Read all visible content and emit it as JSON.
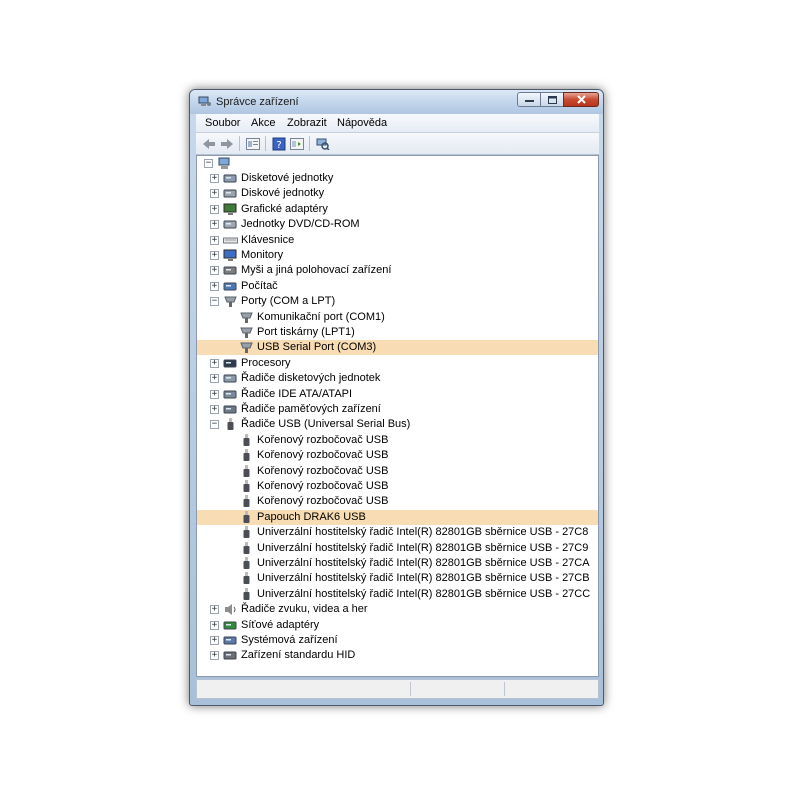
{
  "window": {
    "title": "Správce zařízení",
    "accent_color": "#f8dcb3"
  },
  "menu": [
    {
      "label": "Soubor"
    },
    {
      "label": "Akce"
    },
    {
      "label": "Zobrazit"
    },
    {
      "label": "Nápověda"
    }
  ],
  "toolbar": {
    "icons": [
      "back-arrow-icon",
      "forward-arrow-icon",
      "view-tree-icon",
      "help-icon",
      "properties-icon",
      "scan-hardware-icon"
    ]
  },
  "tree": {
    "root_icon": "computer-icon",
    "items": [
      {
        "label": "Disketové jednotky",
        "level": 1,
        "expander": "+",
        "icon": "floppy-drive-icon"
      },
      {
        "label": "Diskové jednotky",
        "level": 1,
        "expander": "+",
        "icon": "hard-disk-icon"
      },
      {
        "label": "Grafické adaptéry",
        "level": 1,
        "expander": "+",
        "icon": "display-adapter-icon"
      },
      {
        "label": "Jednotky DVD/CD-ROM",
        "level": 1,
        "expander": "+",
        "icon": "dvd-drive-icon"
      },
      {
        "label": "Klávesnice",
        "level": 1,
        "expander": "+",
        "icon": "keyboard-icon"
      },
      {
        "label": "Monitory",
        "level": 1,
        "expander": "+",
        "icon": "monitor-icon"
      },
      {
        "label": "Myši a jiná polohovací zařízení",
        "level": 1,
        "expander": "+",
        "icon": "mouse-icon"
      },
      {
        "label": "Počítač",
        "level": 1,
        "expander": "+",
        "icon": "computer-icon"
      },
      {
        "label": "Porty (COM a LPT)",
        "level": 1,
        "expander": "−",
        "icon": "port-icon"
      },
      {
        "label": "Komunikační port (COM1)",
        "level": 2,
        "expander": "",
        "icon": "port-icon"
      },
      {
        "label": "Port tiskárny (LPT1)",
        "level": 2,
        "expander": "",
        "icon": "port-icon"
      },
      {
        "label": "USB Serial Port (COM3)",
        "level": 2,
        "expander": "",
        "icon": "port-icon",
        "selected": true
      },
      {
        "label": "Procesory",
        "level": 1,
        "expander": "+",
        "icon": "processor-icon"
      },
      {
        "label": "Řadiče disketových jednotek",
        "level": 1,
        "expander": "+",
        "icon": "floppy-controller-icon"
      },
      {
        "label": "Řadiče IDE ATA/ATAPI",
        "level": 1,
        "expander": "+",
        "icon": "ide-controller-icon"
      },
      {
        "label": "Řadiče paměťových zařízení",
        "level": 1,
        "expander": "+",
        "icon": "storage-controller-icon"
      },
      {
        "label": "Řadiče USB (Universal Serial Bus)",
        "level": 1,
        "expander": "−",
        "icon": "usb-icon"
      },
      {
        "label": "Kořenový rozbočovač USB",
        "level": 2,
        "expander": "",
        "icon": "usb-icon"
      },
      {
        "label": "Kořenový rozbočovač USB",
        "level": 2,
        "expander": "",
        "icon": "usb-icon"
      },
      {
        "label": "Kořenový rozbočovač USB",
        "level": 2,
        "expander": "",
        "icon": "usb-icon"
      },
      {
        "label": "Kořenový rozbočovač USB",
        "level": 2,
        "expander": "",
        "icon": "usb-icon"
      },
      {
        "label": "Kořenový rozbočovač USB",
        "level": 2,
        "expander": "",
        "icon": "usb-icon"
      },
      {
        "label": "Papouch DRAK6 USB",
        "level": 2,
        "expander": "",
        "icon": "usb-icon",
        "selected": true
      },
      {
        "label": "Univerzální hostitelský řadič Intel(R) 82801GB sběrnice USB - 27C8",
        "level": 2,
        "expander": "",
        "icon": "usb-icon"
      },
      {
        "label": "Univerzální hostitelský řadič Intel(R) 82801GB sběrnice USB - 27C9",
        "level": 2,
        "expander": "",
        "icon": "usb-icon"
      },
      {
        "label": "Univerzální hostitelský řadič Intel(R) 82801GB sběrnice USB - 27CA",
        "level": 2,
        "expander": "",
        "icon": "usb-icon"
      },
      {
        "label": "Univerzální hostitelský řadič Intel(R) 82801GB sběrnice USB - 27CB",
        "level": 2,
        "expander": "",
        "icon": "usb-icon"
      },
      {
        "label": "Univerzální hostitelský řadič Intel(R) 82801GB sběrnice USB - 27CC",
        "level": 2,
        "expander": "",
        "icon": "usb-icon"
      },
      {
        "label": "Řadiče zvuku, videa a her",
        "level": 1,
        "expander": "+",
        "icon": "speaker-icon"
      },
      {
        "label": "Síťové adaptéry",
        "level": 1,
        "expander": "+",
        "icon": "network-adapter-icon"
      },
      {
        "label": "Systémová zařízení",
        "level": 1,
        "expander": "+",
        "icon": "system-device-icon"
      },
      {
        "label": "Zařízení standardu HID",
        "level": 1,
        "expander": "+",
        "icon": "hid-device-icon"
      }
    ]
  }
}
